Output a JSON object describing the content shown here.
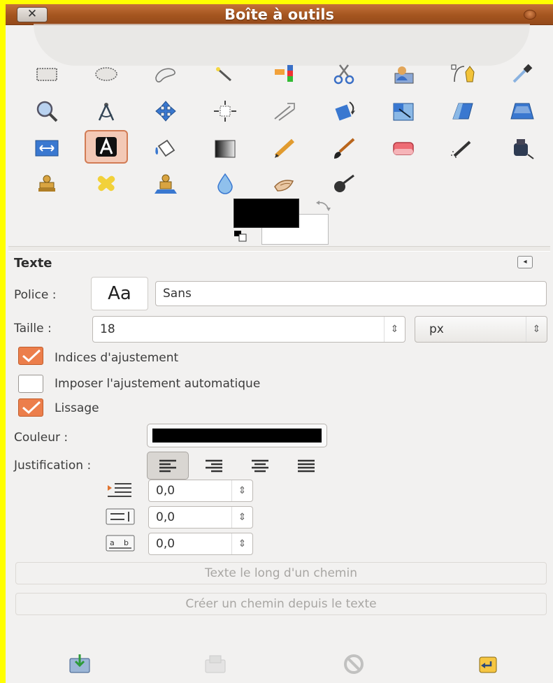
{
  "window": {
    "title": "Boîte à outils",
    "close_label": "✕"
  },
  "tools": [
    {
      "name": "rect-select-icon"
    },
    {
      "name": "ellipse-select-icon"
    },
    {
      "name": "free-select-icon"
    },
    {
      "name": "fuzzy-select-icon"
    },
    {
      "name": "select-by-color-icon"
    },
    {
      "name": "scissors-select-icon"
    },
    {
      "name": "foreground-select-icon"
    },
    {
      "name": "paths-icon"
    },
    {
      "name": "color-picker-icon"
    },
    {
      "name": "zoom-icon"
    },
    {
      "name": "measure-icon"
    },
    {
      "name": "move-icon"
    },
    {
      "name": "align-icon"
    },
    {
      "name": "crop-icon"
    },
    {
      "name": "rotate-icon"
    },
    {
      "name": "scale-icon"
    },
    {
      "name": "shear-icon"
    },
    {
      "name": "perspective-icon"
    },
    {
      "name": "flip-icon"
    },
    {
      "name": "text-icon",
      "active": true
    },
    {
      "name": "bucket-fill-icon"
    },
    {
      "name": "blend-icon"
    },
    {
      "name": "pencil-icon"
    },
    {
      "name": "paintbrush-icon"
    },
    {
      "name": "eraser-icon"
    },
    {
      "name": "airbrush-icon"
    },
    {
      "name": "ink-icon"
    },
    {
      "name": "clone-icon"
    },
    {
      "name": "heal-icon"
    },
    {
      "name": "perspective-clone-icon"
    },
    {
      "name": "blur-sharpen-icon"
    },
    {
      "name": "smudge-icon"
    },
    {
      "name": "dodge-burn-icon"
    }
  ],
  "colors": {
    "foreground": "#000000",
    "background": "#ffffff",
    "accent": "#ec7e4b"
  },
  "options": {
    "title": "Texte",
    "font_label": "Police :",
    "font_preview": "Aa",
    "font_value": "Sans",
    "size_label": "Taille :",
    "size_value": "18",
    "unit_value": "px",
    "hinting_label": "Indices d'ajustement",
    "hinting_checked": true,
    "force_autohint_label": "Imposer l'ajustement automatique",
    "force_autohint_checked": false,
    "antialias_label": "Lissage",
    "antialias_checked": true,
    "color_label": "Couleur :",
    "justify_label": "Justification :",
    "indent_value": "0,0",
    "line_spacing_value": "0,0",
    "letter_spacing_value": "0,0",
    "path_from_text_label": "Texte le long d'un chemin",
    "create_path_label": "Créer un chemin depuis le texte"
  }
}
